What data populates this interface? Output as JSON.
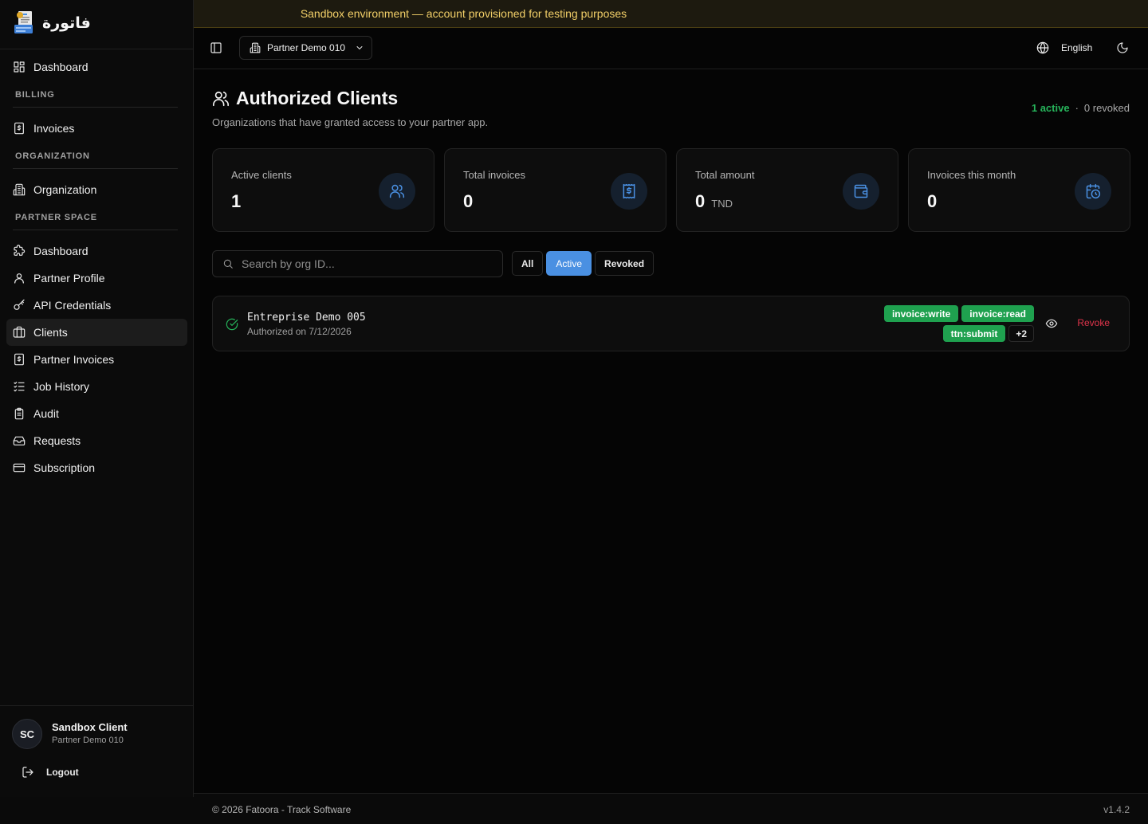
{
  "banner": {
    "text": "Sandbox environment — account provisioned for testing purposes"
  },
  "brand": {
    "name": "فاتورة",
    "logo_icon": "invoice-logo-icon"
  },
  "sidebar": {
    "items": [
      {
        "type": "item",
        "label": "Dashboard",
        "icon": "dashboard-icon"
      },
      {
        "type": "section",
        "label": "BILLING"
      },
      {
        "type": "item",
        "label": "Invoices",
        "icon": "invoice-icon"
      },
      {
        "type": "section",
        "label": "ORGANIZATION"
      },
      {
        "type": "item",
        "label": "Organization",
        "icon": "building-icon"
      },
      {
        "type": "section",
        "label": "PARTNER SPACE"
      },
      {
        "type": "item",
        "label": "Dashboard",
        "icon": "puzzle-icon"
      },
      {
        "type": "item",
        "label": "Partner Profile",
        "icon": "user-icon"
      },
      {
        "type": "item",
        "label": "API Credentials",
        "icon": "key-icon"
      },
      {
        "type": "item",
        "label": "Clients",
        "icon": "briefcase-icon",
        "active": true
      },
      {
        "type": "item",
        "label": "Partner Invoices",
        "icon": "invoice-icon"
      },
      {
        "type": "item",
        "label": "Job History",
        "icon": "list-checks-icon"
      },
      {
        "type": "item",
        "label": "Audit",
        "icon": "clipboard-icon"
      },
      {
        "type": "item",
        "label": "Requests",
        "icon": "inbox-icon"
      },
      {
        "type": "item",
        "label": "Subscription",
        "icon": "credit-card-icon"
      }
    ]
  },
  "user": {
    "initials": "SC",
    "name": "Sandbox Client",
    "org": "Partner Demo 010",
    "logout_label": "Logout"
  },
  "topbar": {
    "org_selector": "Partner Demo 010",
    "language": "English"
  },
  "page": {
    "title": "Authorized Clients",
    "subtitle": "Organizations that have granted access to your partner app.",
    "summary_active": "1 active",
    "summary_sep": "·",
    "summary_revoked": "0 revoked"
  },
  "stats": [
    {
      "label": "Active clients",
      "value": "1",
      "unit": "",
      "icon": "users-icon"
    },
    {
      "label": "Total invoices",
      "value": "0",
      "unit": "",
      "icon": "receipt-icon"
    },
    {
      "label": "Total amount",
      "value": "0",
      "unit": "TND",
      "icon": "wallet-icon"
    },
    {
      "label": "Invoices this month",
      "value": "0",
      "unit": "",
      "icon": "calendar-clock-icon"
    }
  ],
  "search": {
    "placeholder": "Search by org ID..."
  },
  "filters": {
    "all": "All",
    "active": "Active",
    "revoked": "Revoked",
    "selected": "Active"
  },
  "clients": [
    {
      "name": "Entreprise Demo 005",
      "authorized": "Authorized on 7/12/2026",
      "scopes": [
        "invoice:write",
        "invoice:read",
        "ttn:submit"
      ],
      "more": "+2",
      "revoke_label": "Revoke",
      "status_color": "#26b35a"
    }
  ],
  "footer": {
    "copyright": "© 2026 Fatoora - Track Software",
    "version": "v1.4.2"
  },
  "colors": {
    "accent": "#4a90e2",
    "success": "#26b35a",
    "danger": "#e0344b",
    "warning": "#f2cf68"
  }
}
